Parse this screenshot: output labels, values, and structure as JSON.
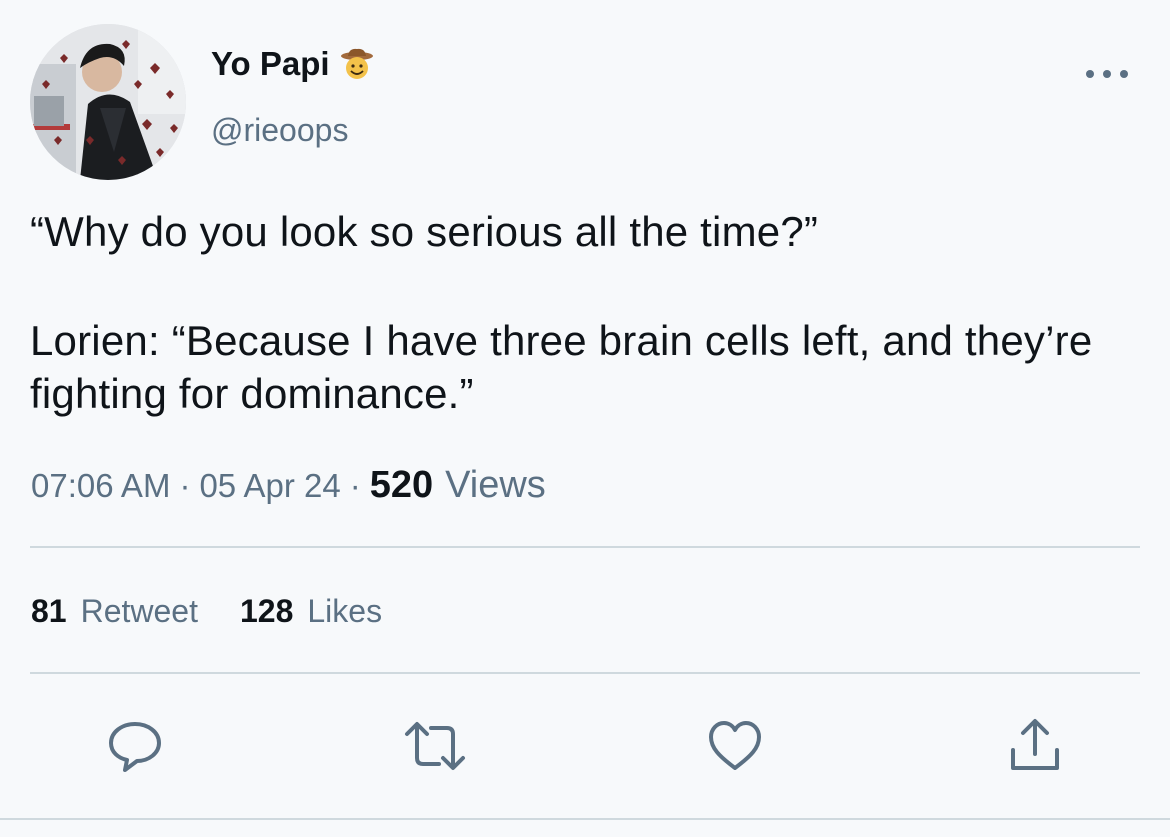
{
  "user": {
    "display_name": "Yo Papi",
    "name_emoji_icon": "cowboy-emoji-icon",
    "handle": "@rieoops",
    "avatar": "profile-photo-with-hearts"
  },
  "tweet": {
    "line1": "“Why do you look so serious all the time?”",
    "line2": "Lorien: “Because I have three brain cells left, and they’re fighting for dominance.”"
  },
  "meta": {
    "time": "07:06 AM",
    "separator": "·",
    "date": "05 Apr 24",
    "views_count": "520",
    "views_label": "Views"
  },
  "stats": {
    "retweets_count": "81",
    "retweets_label": "Retweet",
    "likes_count": "128",
    "likes_label": "Likes"
  },
  "actions": {
    "reply_icon": "reply-icon",
    "retweet_icon": "retweet-icon",
    "like_icon": "heart-icon",
    "share_icon": "share-icon"
  },
  "colors": {
    "background": "#f7f9fb",
    "text_primary": "#0f1419",
    "text_secondary": "#5b7083",
    "divider": "#cfd9de",
    "hearts": "#7a2a2a"
  }
}
